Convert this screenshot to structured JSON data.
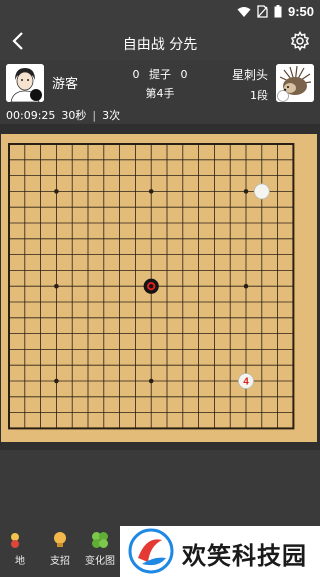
{
  "status_bar": {
    "time": "9:50"
  },
  "header": {
    "title": "自由战 分先"
  },
  "players": {
    "left": {
      "name": "游客",
      "stone_color": "black"
    },
    "right": {
      "name": "星刺头",
      "rank": "1段",
      "stone_color": "white"
    },
    "captures_label": "提子",
    "captures_left": "0",
    "captures_right": "0",
    "move_label": "第4手"
  },
  "timer": {
    "main_time": "00:09:25",
    "byoyomi": "30秒",
    "periods": "3次"
  },
  "board": {
    "size": 19,
    "stones": [
      {
        "col": 16,
        "row": 3,
        "color": "white"
      },
      {
        "col": 9,
        "row": 9,
        "color": "black",
        "last_move": true
      },
      {
        "col": 15,
        "row": 15,
        "color": "white",
        "label": "4"
      }
    ],
    "colors": {
      "board": "#e3bc7a",
      "line": "#2a1f14"
    }
  },
  "toolbar": {
    "items": [
      {
        "label": "地"
      },
      {
        "label": "支招"
      },
      {
        "label": "变化图"
      }
    ]
  },
  "watermark": {
    "text": "欢笑科技园"
  }
}
